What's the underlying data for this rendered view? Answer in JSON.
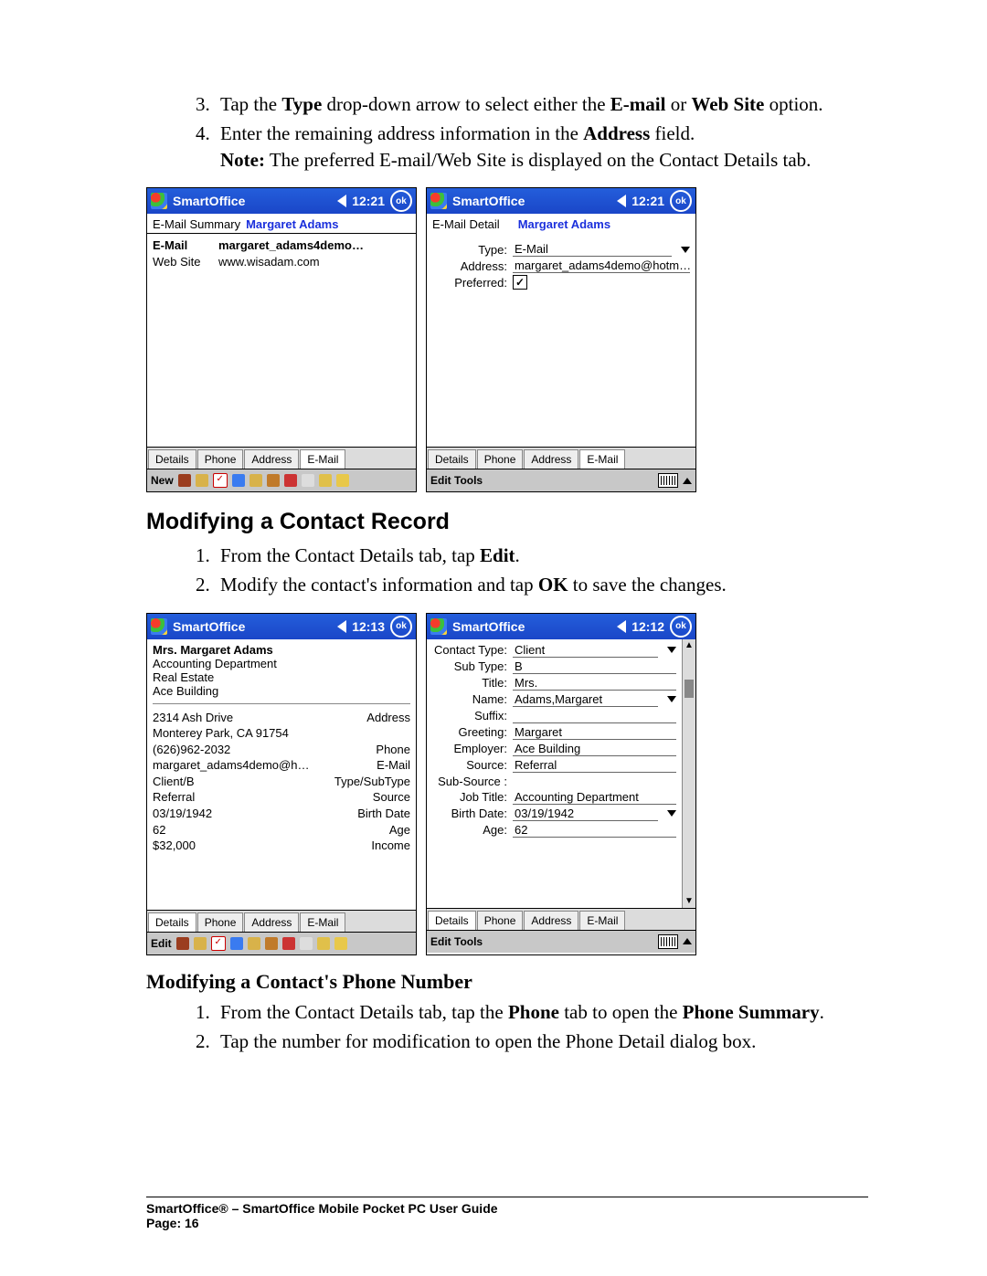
{
  "instructions_top": {
    "step3_parts": [
      "Tap the ",
      "Type",
      " drop-down arrow to select either the ",
      "E-mail",
      " or ",
      "Web Site",
      " option."
    ],
    "step4_parts": [
      "Enter the remaining address information in the ",
      "Address",
      " field."
    ],
    "note_parts": [
      "Note:",
      " The preferred E-mail/Web Site is displayed on the Contact Details tab."
    ]
  },
  "heading1": "Modifying a Contact Record",
  "instructions_mid": {
    "step1_parts": [
      "From the Contact Details tab, tap ",
      "Edit",
      "."
    ],
    "step2_parts": [
      "Modify the contact's information and tap ",
      "OK",
      " to save the changes."
    ]
  },
  "heading2": "Modifying a Contact's Phone Number",
  "instructions_bot": {
    "step1_parts": [
      "From the Contact Details tab, tap the ",
      "Phone",
      " tab to open the ",
      "Phone Summary",
      "."
    ],
    "step2": "Tap the number for modification to open the Phone Detail dialog box."
  },
  "footer": {
    "line1": "SmartOffice® – SmartOffice Mobile Pocket PC User Guide",
    "line2": "Page: 16"
  },
  "pda": {
    "app_name": "SmartOffice",
    "ok": "ok",
    "tabs": [
      "Details",
      "Phone",
      "Address",
      "E-Mail"
    ],
    "menu_new": "New",
    "menu_edit": "Edit",
    "menu_edit_tools": "Edit  Tools"
  },
  "s1": {
    "time": "12:21",
    "sub_label": "E-Mail Summary",
    "sub_value": "Margaret Adams",
    "rows": [
      {
        "label": "E-Mail",
        "value": "margaret_adams4demo…",
        "bold": true
      },
      {
        "label": "Web Site",
        "value": "www.wisadam.com",
        "bold": false
      }
    ]
  },
  "s2": {
    "time": "12:21",
    "sub_label": "E-Mail Detail",
    "sub_value": "Margaret Adams",
    "type_label": "Type:",
    "type_value": "E-Mail",
    "address_label": "Address:",
    "address_value": "margaret_adams4demo@hotm…",
    "preferred_label": "Preferred:",
    "preferred_checked": "✓"
  },
  "s3": {
    "time": "12:13",
    "name": "Mrs. Margaret Adams",
    "lines": [
      "Accounting Department",
      "Real Estate",
      "Ace Building"
    ],
    "details": [
      {
        "l": "2314 Ash Drive",
        "r": "Address"
      },
      {
        "l": "Monterey Park, CA 91754",
        "r": ""
      },
      {
        "l": "(626)962-2032",
        "r": "Phone"
      },
      {
        "l": "margaret_adams4demo@h…",
        "r": "E-Mail"
      },
      {
        "l": "Client/B",
        "r": "Type/SubType"
      },
      {
        "l": "Referral",
        "r": "Source"
      },
      {
        "l": "03/19/1942",
        "r": "Birth Date"
      },
      {
        "l": "62",
        "r": "Age"
      },
      {
        "l": "$32,000",
        "r": "Income"
      }
    ]
  },
  "s4": {
    "time": "12:12",
    "fields": [
      {
        "l": "Contact Type:",
        "v": "Client",
        "dd": true
      },
      {
        "l": "Sub Type:",
        "v": "B"
      },
      {
        "l": "Title:",
        "v": "Mrs."
      },
      {
        "l": "Name:",
        "v": "Adams,Margaret",
        "dd": true
      },
      {
        "l": "Suffix:",
        "v": ""
      },
      {
        "l": "Greeting:",
        "v": "Margaret"
      },
      {
        "l": "Employer:",
        "v": "Ace Building"
      },
      {
        "l": "Source:",
        "v": "Referral"
      },
      {
        "l": "Sub-Source :",
        "v": "",
        "nb": true
      },
      {
        "l": "Job Title:",
        "v": "Accounting Department"
      },
      {
        "l": "Birth Date:",
        "v": "03/19/1942",
        "dd": true
      },
      {
        "l": "Age:",
        "v": "62"
      }
    ]
  }
}
